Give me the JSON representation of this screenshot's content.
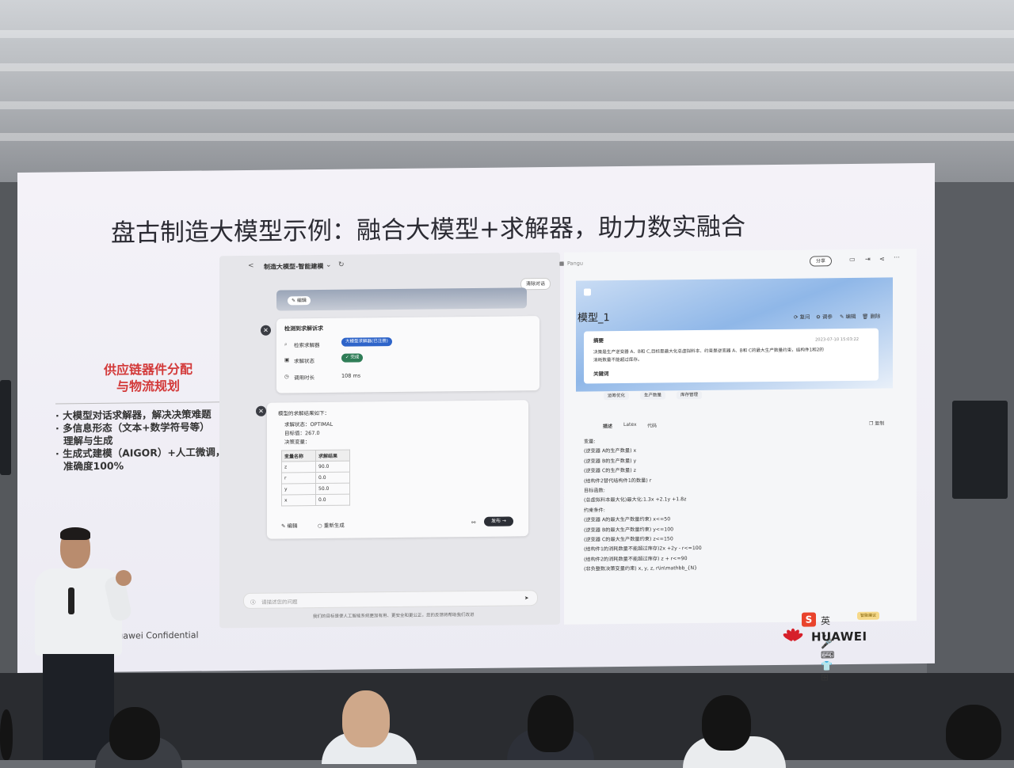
{
  "slide": {
    "title": "盘古制造大模型示例：融合大模型+求解器，助力数实融合",
    "red_heading_line1": "供应链器件分配",
    "red_heading_line2": "与物流规划",
    "bullets": [
      "· 大模型对话求解器，解决决策难题",
      "· 多信息形态（文本+数学符号等）",
      "  理解与生成",
      "· 生成式建模（AIGOR）+人工微调，",
      "  准确度100%"
    ],
    "confidential": "Huawei Confidential",
    "logo_text": "HUAWEI"
  },
  "app_left": {
    "back": "<",
    "title": "制造大模型-智能建模",
    "clear_label": "清除对话",
    "edit_label": "✎ 编辑",
    "detect_title": "检测到求解诉求",
    "rows": [
      {
        "label": "检索求解器",
        "value": "大模型求解器(已注册)"
      },
      {
        "label": "求解状态",
        "value": "✓ 完成"
      },
      {
        "label": "调用时长",
        "value": "108 ms"
      }
    ],
    "result_intro": "模型的求解结果如下：",
    "result_items": [
      "求解状态：OPTIMAL",
      "目标值：267.0",
      "决策变量："
    ],
    "table_headers": [
      "变量名称",
      "求解结果"
    ],
    "table_rows": [
      [
        "z",
        "90.0"
      ],
      [
        "r",
        "0.0"
      ],
      [
        "y",
        "50.0"
      ],
      [
        "x",
        "0.0"
      ]
    ],
    "edit_btn": "✎ 编辑",
    "regen_btn": "○ 重新生成",
    "send_btn": "发布 →",
    "input_placeholder": "请描述您的问题",
    "footnote": "我们的目标是使人工智能系统更加有用、更安全和更公正，您的反馈将帮助我们改进"
  },
  "app_right": {
    "brand": "Pangu",
    "model_title": "模型_1",
    "actions": [
      "⟳ 复问",
      "⚙ 调参",
      "✎ 编辑",
      "🗑 删除"
    ],
    "top_btn": "分享",
    "summary_label": "摘要",
    "timestamp": "2023-07-10 15:03:22",
    "summary_text_1": "决策是生产逆变器 A、B和 C,目标是最大化总虚拟料本、约束是逆变器 A、B和 C的最大生产数量约束，结构件1和2的",
    "summary_text_2": "消耗数量不能超过库存。",
    "keywords_label": "关键词",
    "keywords": [
      "运筹优化",
      "生产数量",
      "库存管理"
    ],
    "tabs": [
      "描述",
      "Latex",
      "代码"
    ],
    "copy_label": "❐ 复制",
    "lines": [
      "变量:",
      "(逆变器 A的生产数量) x",
      "(逆变器 B的生产数量) y",
      "(逆变器 C的生产数量) z",
      "(结构件2替代结构件1的数量) r",
      "目标函数:",
      "(总虚拟料本最大化)最大化:1.3x +2.1y +1.8z",
      "约束条件:",
      "(逆变器 A的最大生产数量约束) x<=50",
      "(逆变器 B的最大生产数量约束) y<=100",
      "(逆变器 C的最大生产数量约束) z<=150",
      "(结构件1的消耗数量不能超过库存)2x +2y - r<=100",
      "(结构件2的消耗数量不能超过库存) z + r<=90",
      "(非负整数决策变量约束) x, y, z, r\\in\\mathbb_{N}"
    ],
    "tip_badge": "智能建议"
  },
  "ime": {
    "s": "S",
    "text": "英 ·, 🎤 ⌨ 👕 ⊞"
  }
}
